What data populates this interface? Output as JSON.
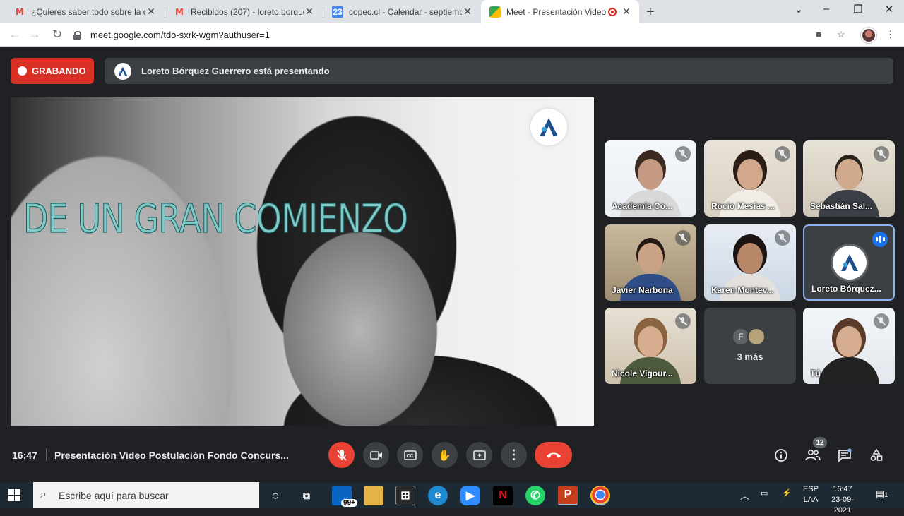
{
  "browser": {
    "tabs": [
      {
        "title": "¿Quieres saber todo sobre la obe",
        "icon": "gmail-icon"
      },
      {
        "title": "Recibidos (207) - loreto.borquez",
        "icon": "gmail-icon"
      },
      {
        "title": "copec.cl - Calendar - septiembre",
        "icon": "calendar-icon",
        "icon_text": "23"
      },
      {
        "title": "Meet - Presentación Video P",
        "icon": "meet-icon",
        "active": true
      }
    ],
    "url": "meet.google.com/tdo-sxrk-wgm?authuser=1"
  },
  "meet": {
    "recording_label": "GRABANDO",
    "presenting_text": "Loreto Bórquez Guerrero está presentando",
    "slide_headline": "DE UN GRAN COMIENZO",
    "participants": [
      {
        "name": "Academia Co..."
      },
      {
        "name": "Rocio Mesías ..."
      },
      {
        "name": "Sebastián Sal..."
      },
      {
        "name": "Javier Narbona"
      },
      {
        "name": "Karen Montev..."
      },
      {
        "name": "Loreto Bórquez..."
      },
      {
        "name": "Nicole Vigour..."
      },
      {
        "name": "3 más",
        "initial": "F"
      },
      {
        "name": "Tú"
      }
    ],
    "time": "16:47",
    "meeting_title": "Presentación Video Postulación Fondo Concurs...",
    "participant_count": "12"
  },
  "taskbar": {
    "search_placeholder": "Escribe aquí para buscar",
    "mail_badge": "99+",
    "lang_top": "ESP",
    "lang_bottom": "LAA",
    "clock_time": "16:47",
    "clock_date": "23-09-2021",
    "notification_count": "1"
  },
  "colors": {
    "meet_bg": "#202124",
    "record_red": "#d93025",
    "leave_red": "#ea4335",
    "active_speaker": "#8ab4f8",
    "headline_teal": "#7fc9c6"
  }
}
